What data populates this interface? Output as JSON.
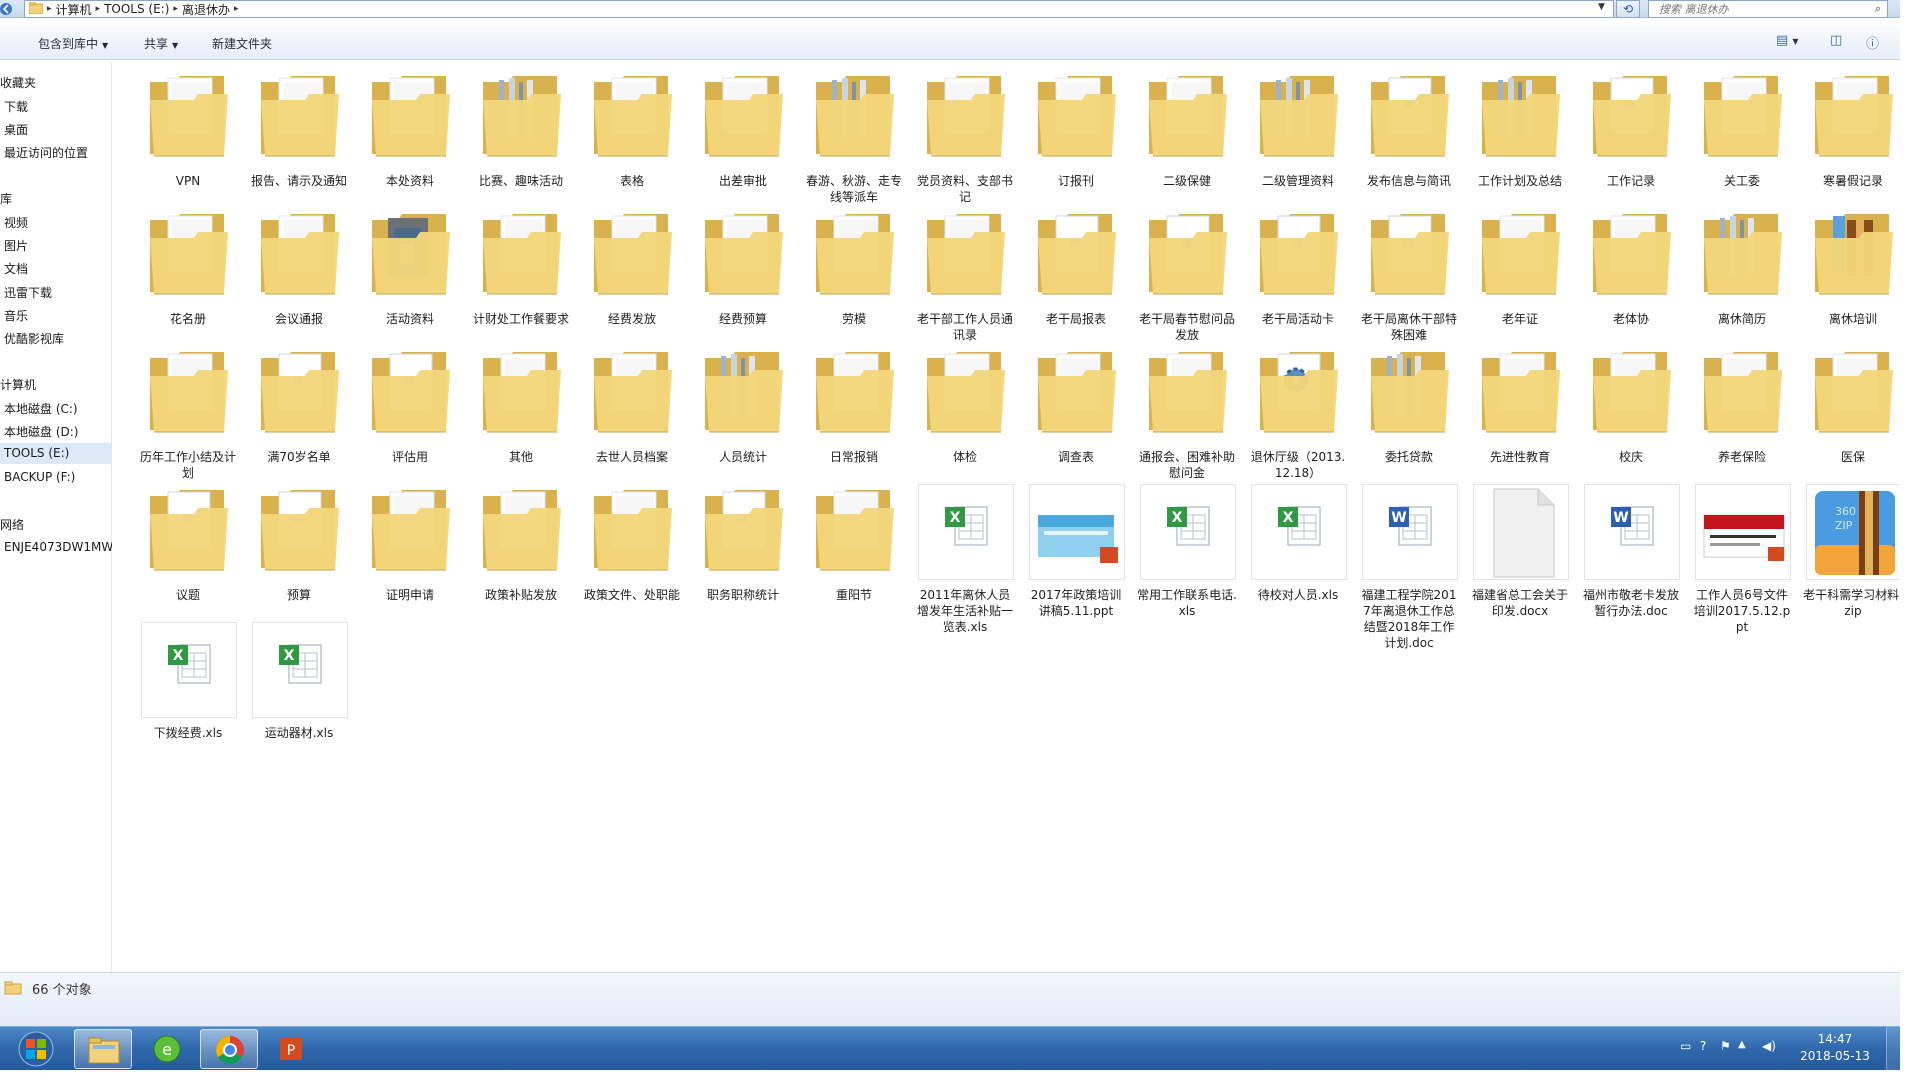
{
  "address": {
    "segments": [
      "计算机",
      "TOOLS (E:)",
      "离退休办"
    ],
    "search_placeholder": "搜索 离退休办"
  },
  "toolbar": {
    "include_library": "包含到库中",
    "share": "共享",
    "new_folder": "新建文件夹"
  },
  "sidebar": {
    "favorites": "收藏夹",
    "download": "下载",
    "desktop": "桌面",
    "recent": "最近访问的位置",
    "libraries": "库",
    "videos": "视频",
    "pictures": "图片",
    "documents": "文档",
    "xunlei": "迅雷下载",
    "music": "音乐",
    "youku": "优酷影视库",
    "computer": "计算机",
    "drive_c": "本地磁盘 (C:)",
    "drive_d": "本地磁盘 (D:)",
    "drive_e": "TOOLS (E:)",
    "drive_f": "BACKUP (F:)",
    "network": "网络",
    "host": "ENJE4073DW1MW"
  },
  "items": [
    {
      "name": "VPN",
      "type": "folder"
    },
    {
      "name": "报告、请示及通知",
      "type": "folder"
    },
    {
      "name": "本处资料",
      "type": "folder"
    },
    {
      "name": "比赛、趣味活动",
      "type": "folder-full"
    },
    {
      "name": "表格",
      "type": "folder"
    },
    {
      "name": "出差审批",
      "type": "folder"
    },
    {
      "name": "春游、秋游、走专线等派车",
      "type": "folder-full"
    },
    {
      "name": "党员资料、支部书记",
      "type": "folder"
    },
    {
      "name": "订报刊",
      "type": "folder"
    },
    {
      "name": "二级保健",
      "type": "folder"
    },
    {
      "name": "二级管理资料",
      "type": "folder-full"
    },
    {
      "name": "发布信息与简讯",
      "type": "folder-doc"
    },
    {
      "name": "工作计划及总结",
      "type": "folder-full"
    },
    {
      "name": "工作记录",
      "type": "folder-doc"
    },
    {
      "name": "关工委",
      "type": "folder"
    },
    {
      "name": "寒暑假记录",
      "type": "folder"
    },
    {
      "name": "花名册",
      "type": "folder"
    },
    {
      "name": "会议通报",
      "type": "folder"
    },
    {
      "name": "活动资料",
      "type": "folder-photo"
    },
    {
      "name": "计财处工作餐要求",
      "type": "folder"
    },
    {
      "name": "经费发放",
      "type": "folder"
    },
    {
      "name": "经费预算",
      "type": "folder"
    },
    {
      "name": "劳模",
      "type": "folder"
    },
    {
      "name": "老干部工作人员通讯录",
      "type": "folder"
    },
    {
      "name": "老干局报表",
      "type": "folder-doc"
    },
    {
      "name": "老干局春节慰问品发放",
      "type": "folder-doc"
    },
    {
      "name": "老干局活动卡",
      "type": "folder-doc"
    },
    {
      "name": "老干局离休干部特殊困难",
      "type": "folder-doc"
    },
    {
      "name": "老年证",
      "type": "folder"
    },
    {
      "name": "老体协",
      "type": "folder"
    },
    {
      "name": "离休简历",
      "type": "folder-full"
    },
    {
      "name": "离休培训",
      "type": "folder-zip"
    },
    {
      "name": "历年工作小结及计划",
      "type": "folder"
    },
    {
      "name": "满70岁名单",
      "type": "folder-doc"
    },
    {
      "name": "评估用",
      "type": "folder-doc"
    },
    {
      "name": "其他",
      "type": "folder"
    },
    {
      "name": "去世人员档案",
      "type": "folder"
    },
    {
      "name": "人员统计",
      "type": "folder-full"
    },
    {
      "name": "日常报销",
      "type": "folder"
    },
    {
      "name": "体检",
      "type": "folder"
    },
    {
      "name": "调查表",
      "type": "folder"
    },
    {
      "name": "通报会、困难补助慰问金",
      "type": "folder"
    },
    {
      "name": "退休厅级（2013.12.18）",
      "type": "folder-gear"
    },
    {
      "name": "委托贷款",
      "type": "folder-full"
    },
    {
      "name": "先进性教育",
      "type": "folder"
    },
    {
      "name": "校庆",
      "type": "folder"
    },
    {
      "name": "养老保险",
      "type": "folder"
    },
    {
      "name": "医保",
      "type": "folder"
    },
    {
      "name": "议题",
      "type": "folder-doc"
    },
    {
      "name": "预算",
      "type": "folder-doc"
    },
    {
      "name": "证明申请",
      "type": "folder"
    },
    {
      "name": "政策补贴发放",
      "type": "folder"
    },
    {
      "name": "政策文件、处职能",
      "type": "folder"
    },
    {
      "name": "职务职称统计",
      "type": "folder-doc"
    },
    {
      "name": "重阳节",
      "type": "folder"
    },
    {
      "name": "2011年离休人员增发年生活补贴一览表.xls",
      "type": "xls"
    },
    {
      "name": "2017年政策培训讲稿5.11.ppt",
      "type": "ppt-blue"
    },
    {
      "name": "常用工作联系电话.xls",
      "type": "xls"
    },
    {
      "name": "待校对人员.xls",
      "type": "xls"
    },
    {
      "name": "福建工程学院2017年离退休工作总结暨2018年工作计划.doc",
      "type": "doc"
    },
    {
      "name": "福建省总工会关于印发.docx",
      "type": "blank"
    },
    {
      "name": "福州市敬老卡发放暂行办法.doc",
      "type": "doc"
    },
    {
      "name": "工作人员6号文件培训2017.5.12.ppt",
      "type": "ppt-red"
    },
    {
      "name": "老干科需学习材料.zip",
      "type": "zip"
    },
    {
      "name": "下拨经费.xls",
      "type": "xls"
    },
    {
      "name": "运动器材.xls",
      "type": "xls"
    }
  ],
  "status": {
    "count": "66 个对象"
  },
  "clock": {
    "time": "14:47",
    "date": "2018-05-13"
  },
  "colors": {
    "folder": "#f3d67a",
    "folder_dark": "#d9b24e",
    "taskbar": "#2f68ab",
    "selection": "#dde9f7"
  }
}
